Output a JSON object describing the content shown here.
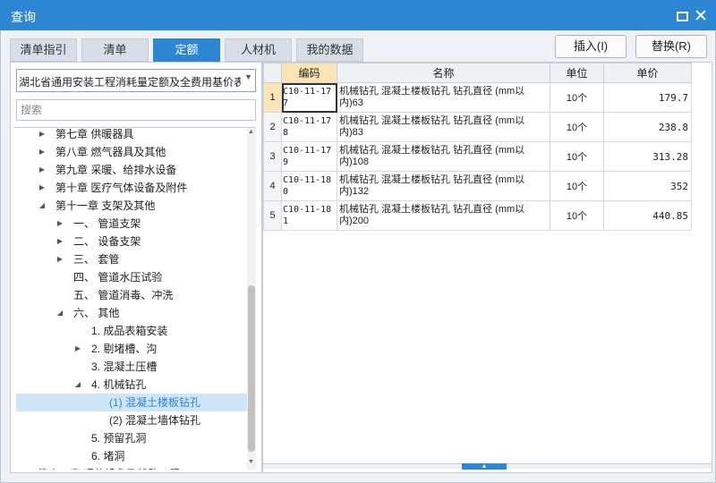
{
  "window": {
    "title": "查询"
  },
  "tabs": [
    {
      "label": "清单指引"
    },
    {
      "label": "清单"
    },
    {
      "label": "定额"
    },
    {
      "label": "人材机"
    },
    {
      "label": "我的数据"
    }
  ],
  "active_tab": "定额",
  "buttons": {
    "insert": "插入(I)",
    "replace": "替换(R)"
  },
  "library_select": {
    "value": "湖北省通用安装工程消耗量定额及全费用基价表"
  },
  "search": {
    "placeholder": "搜索"
  },
  "tree": [
    {
      "label": "第七章 供暖器具",
      "expander": "collapsed"
    },
    {
      "label": "第八章 燃气器具及其他",
      "expander": "collapsed"
    },
    {
      "label": "第九章 采暖、给排水设备",
      "expander": "collapsed"
    },
    {
      "label": "第十章 医疗气体设备及附件",
      "expander": "collapsed"
    },
    {
      "label": "第十一章 支架及其他",
      "expander": "expanded"
    },
    {
      "label": "一、 管道支架",
      "expander": "collapsed"
    },
    {
      "label": "二、 设备支架",
      "expander": "collapsed"
    },
    {
      "label": "三、 套管",
      "expander": "collapsed"
    },
    {
      "label": "四、 管道水压试验",
      "expander": "none"
    },
    {
      "label": "五、 管道消毒、冲洗",
      "expander": "none"
    },
    {
      "label": "六、 其他",
      "expander": "expanded"
    },
    {
      "label": "1. 成品表箱安装",
      "expander": "none"
    },
    {
      "label": "2. 剔堵槽、沟",
      "expander": "collapsed"
    },
    {
      "label": "3. 混凝土压槽",
      "expander": "none"
    },
    {
      "label": "4. 机械钻孔",
      "expander": "expanded"
    },
    {
      "label": "(1) 混凝土楼板钻孔",
      "expander": "none",
      "selected": true
    },
    {
      "label": "(2) 混凝土墙体钻孔",
      "expander": "none"
    },
    {
      "label": "5. 预留孔洞",
      "expander": "none"
    },
    {
      "label": "6. 堵洞",
      "expander": "none"
    },
    {
      "label": "第十二章 通信设备及线路工程",
      "expander": "collapsed"
    }
  ],
  "grid": {
    "columns": [
      "编码",
      "名称",
      "单位",
      "单价"
    ],
    "rows": [
      {
        "no": "1",
        "code": "C10-11-177",
        "name": "机械钻孔 混凝土楼板钻孔 钻孔直径 (mm以内)63",
        "unit": "10个",
        "price": "179.7"
      },
      {
        "no": "2",
        "code": "C10-11-178",
        "name": "机械钻孔 混凝土楼板钻孔 钻孔直径 (mm以内)83",
        "unit": "10个",
        "price": "238.8"
      },
      {
        "no": "3",
        "code": "C10-11-179",
        "name": "机械钻孔 混凝土楼板钻孔 钻孔直径 (mm以内)108",
        "unit": "10个",
        "price": "313.28"
      },
      {
        "no": "4",
        "code": "C10-11-180",
        "name": "机械钻孔 混凝土楼板钻孔 钻孔直径 (mm以内)132",
        "unit": "10个",
        "price": "352"
      },
      {
        "no": "5",
        "code": "C10-11-181",
        "name": "机械钻孔 混凝土楼板钻孔 钻孔直径 (mm以内)200",
        "unit": "10个",
        "price": "440.85"
      }
    ]
  },
  "colors": {
    "accent": "#2d86d4",
    "selection": "#cde5f7",
    "highlight": "#fce4b5"
  }
}
